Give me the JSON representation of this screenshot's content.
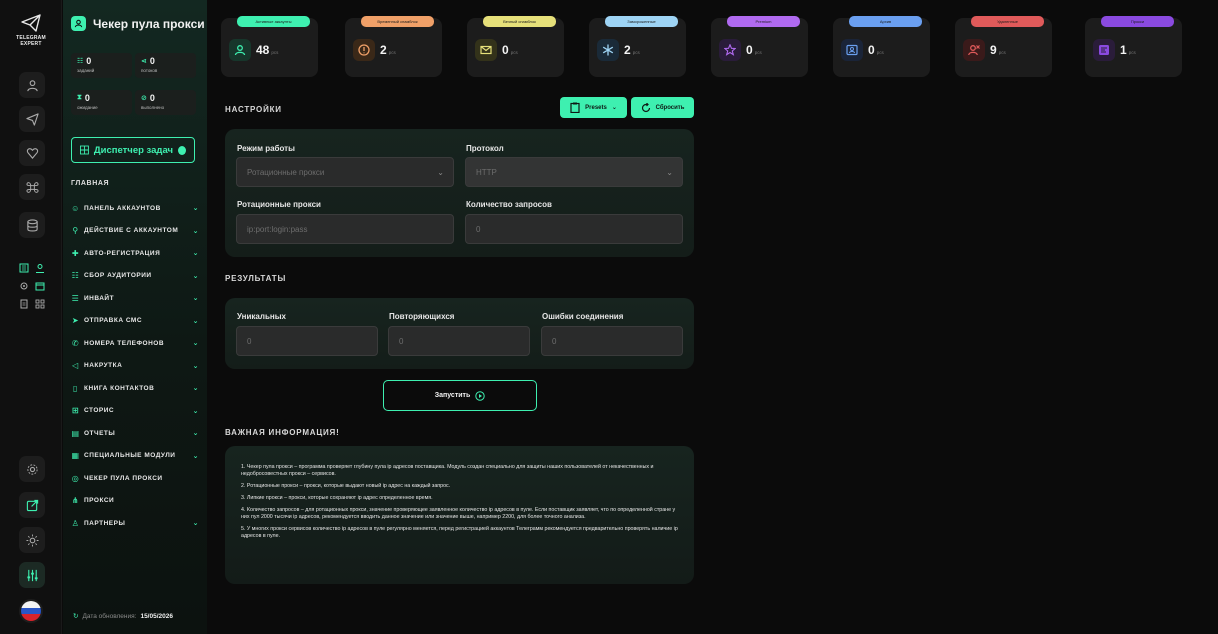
{
  "brand": {
    "name_line1": "TELEGRAM",
    "name_line2": "EXPERT"
  },
  "sidebar": {
    "title": "Чекер пула прокси",
    "stats": [
      {
        "value": "0",
        "label": "заданий"
      },
      {
        "value": "0",
        "label": "потоков"
      },
      {
        "value": "0",
        "label": "ожидание"
      },
      {
        "value": "0",
        "label": "выполнено"
      }
    ],
    "dispatcher": "Диспетчер задач",
    "section": "ГЛАВНАЯ",
    "nav": [
      {
        "label": "ПАНЕЛЬ АККАУНТОВ",
        "chevron": true
      },
      {
        "label": "ДЕЙСТВИЕ С АККАУНТОМ",
        "chevron": true
      },
      {
        "label": "АВТО-РЕГИСТРАЦИЯ",
        "chevron": true
      },
      {
        "label": "СБОР АУДИТОРИИ",
        "chevron": true
      },
      {
        "label": "ИНВАЙТ",
        "chevron": true
      },
      {
        "label": "ОТПРАВКА СМС",
        "chevron": true
      },
      {
        "label": "НОМЕРА ТЕЛЕФОНОВ",
        "chevron": true
      },
      {
        "label": "НАКРУТКА",
        "chevron": true
      },
      {
        "label": "КНИГА КОНТАКТОВ",
        "chevron": true
      },
      {
        "label": "СТОРИС",
        "chevron": true
      },
      {
        "label": "ОТЧЕТЫ",
        "chevron": true
      },
      {
        "label": "СПЕЦИАЛЬНЫЕ МОДУЛИ",
        "chevron": true
      },
      {
        "label": "ЧЕКЕР ПУЛА ПРОКСИ",
        "chevron": false
      },
      {
        "label": "ПРОКСИ",
        "chevron": false
      },
      {
        "label": "ПАРТНЕРЫ",
        "chevron": true
      }
    ],
    "updated_label": "Дата обновления:",
    "updated_date": "15/05/2026"
  },
  "counters": [
    {
      "label": "Активные аккаунты",
      "value": "48",
      "unit": "pcs",
      "color": "#3ef0b0",
      "icon": "user-icon"
    },
    {
      "label": "Временный спамблок",
      "value": "2",
      "unit": "pcs",
      "color": "#f0a068",
      "icon": "alert-icon"
    },
    {
      "label": "Вечный спамблок",
      "value": "0",
      "unit": "pcs",
      "color": "#e6e07a",
      "icon": "mail-icon"
    },
    {
      "label": "Замороженные",
      "value": "2",
      "unit": "pcs",
      "color": "#9ed4f5",
      "icon": "snowflake-icon"
    },
    {
      "label": "Premium",
      "value": "0",
      "unit": "pcs",
      "color": "#b06af0",
      "icon": "star-icon"
    },
    {
      "label": "Архив",
      "value": "0",
      "unit": "pcs",
      "color": "#6a9ff0",
      "icon": "archive-icon"
    },
    {
      "label": "Удаленные",
      "value": "9",
      "unit": "pcs",
      "color": "#e05a5a",
      "icon": "user-remove-icon"
    },
    {
      "label": "Прокси",
      "value": "1",
      "unit": "pcs",
      "color": "#8a4ae0",
      "icon": "proxy-icon"
    }
  ],
  "settings": {
    "title": "НАСТРОЙКИ",
    "presets_label": "Presets",
    "reset_label": "Сбросить",
    "mode_label": "Режим работы",
    "mode_value": "Ротационные прокси",
    "protocol_label": "Протокол",
    "protocol_value": "HTTP",
    "rotating_label": "Ротационные прокси",
    "rotating_placeholder": "ip:port:login:pass",
    "requests_label": "Количество запросов",
    "requests_placeholder": "0"
  },
  "results": {
    "title": "РЕЗУЛЬТАТЫ",
    "unique_label": "Уникальных",
    "unique_value": "0",
    "repeat_label": "Повторяющихся",
    "repeat_value": "0",
    "errors_label": "Ошибки соединения",
    "errors_value": "0"
  },
  "run_label": "Запустить",
  "info": {
    "title": "ВАЖНАЯ ИНФОРМАЦИЯ!",
    "items": [
      "1. Чекер пула прокси – программа проверяет глубину пула ip адресов поставщика. Модуль создан специально для защиты наших пользователей от некачественных и недобросовестных прокси – сервисов.",
      "2. Ротационные прокси – прокси, которые выдают новый ip адрес на каждый запрос.",
      "3. Липкие прокси – прокси, которые сохраняют ip адрес определенное время.",
      "4. Количество запросов – для ротационных прокси, значение проверяющее заявленное количество ip адресов в пуле. Если поставщик заявляет, что по определенной стране у них пул 2000 тысячи ip адресов, рекомендуется вводить данное значение или значение выше, например 2200, для более точного анализа.",
      "5. У многих прокси сервисов количество ip адресов в пуле регулярно меняется, перед регистрацией аккаунтов Телеграмм рекомендуется предварительно проверять наличие ip адресов в пуле."
    ]
  }
}
